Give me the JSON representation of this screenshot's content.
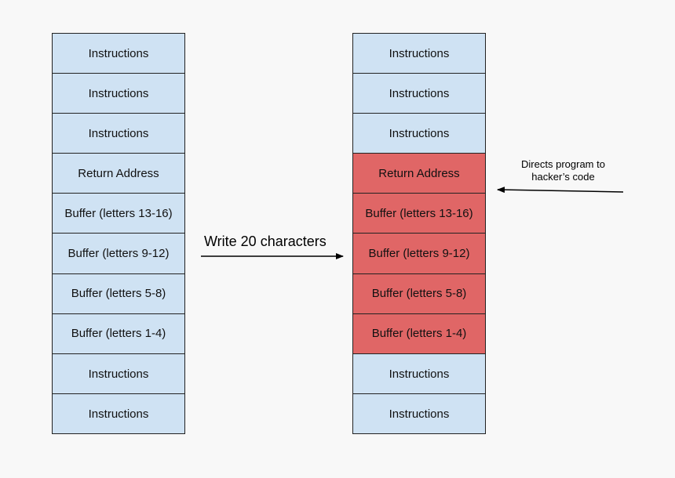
{
  "colors": {
    "normal": "#cfe2f3",
    "overwritten": "#e06666",
    "background": "#f8f8f8",
    "line": "#222222"
  },
  "left_stack": [
    {
      "label": "Instructions",
      "state": "normal"
    },
    {
      "label": "Instructions",
      "state": "normal"
    },
    {
      "label": "Instructions",
      "state": "normal"
    },
    {
      "label": "Return Address",
      "state": "normal"
    },
    {
      "label": "Buffer (letters 13-16)",
      "state": "normal"
    },
    {
      "label": "Buffer (letters 9-12)",
      "state": "normal"
    },
    {
      "label": "Buffer (letters 5-8)",
      "state": "normal"
    },
    {
      "label": "Buffer (letters 1-4)",
      "state": "normal"
    },
    {
      "label": "Instructions",
      "state": "normal"
    },
    {
      "label": "Instructions",
      "state": "normal"
    }
  ],
  "right_stack": [
    {
      "label": "Instructions",
      "state": "normal"
    },
    {
      "label": "Instructions",
      "state": "normal"
    },
    {
      "label": "Instructions",
      "state": "normal"
    },
    {
      "label": "Return Address",
      "state": "overwritten"
    },
    {
      "label": "Buffer (letters 13-16)",
      "state": "overwritten"
    },
    {
      "label": "Buffer (letters 9-12)",
      "state": "overwritten"
    },
    {
      "label": "Buffer (letters 5-8)",
      "state": "overwritten"
    },
    {
      "label": "Buffer (letters 1-4)",
      "state": "overwritten"
    },
    {
      "label": "Instructions",
      "state": "normal"
    },
    {
      "label": "Instructions",
      "state": "normal"
    }
  ],
  "arrows": {
    "write_label": "Write 20 characters",
    "directs_label": "Directs program to hacker’s code"
  }
}
